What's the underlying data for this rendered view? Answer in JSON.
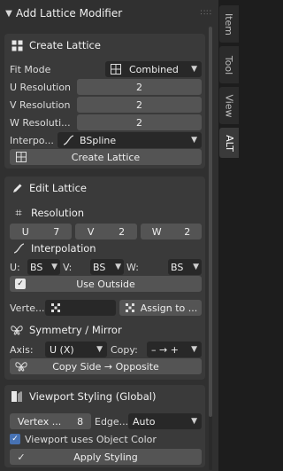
{
  "header": {
    "title": "Add Lattice Modifier"
  },
  "create": {
    "title": "Create Lattice",
    "fit_mode_label": "Fit Mode",
    "fit_mode_value": "Combined",
    "u_label": "U Resolution",
    "u_value": "2",
    "v_label": "V Resolution",
    "v_value": "2",
    "w_label": "W Resoluti...",
    "w_value": "2",
    "interp_label": "Interpo...",
    "interp_value": "BSpline",
    "button": "Create Lattice"
  },
  "edit": {
    "title": "Edit Lattice",
    "resolution_title": "Resolution",
    "u": "U",
    "u_val": "7",
    "v": "V",
    "v_val": "2",
    "w": "W",
    "w_val": "2",
    "interp_title": "Interpolation",
    "u_lbl": "U:",
    "u_sel": "BS",
    "v_lbl": "V:",
    "v_sel": "BS",
    "w_lbl": "W:",
    "w_sel": "BS",
    "use_outside": "Use Outside",
    "vertex_label": "Verte...",
    "assign": "Assign to ..."
  },
  "symmetry": {
    "title": "Symmetry / Mirror",
    "axis_label": "Axis:",
    "axis_value": "U (X)",
    "copy_label": "Copy:",
    "copy_value": "– → +",
    "button": "Copy Side → Opposite"
  },
  "viewport": {
    "title": "Viewport Styling (Global)",
    "vertex_label": "Vertex ...",
    "vertex_value": "8",
    "edge_label": "Edge...",
    "edge_value": "Auto",
    "use_object_color": "Viewport uses Object Color",
    "apply": "Apply Styling"
  },
  "tabs": [
    "Item",
    "Tool",
    "View",
    "ALT"
  ]
}
